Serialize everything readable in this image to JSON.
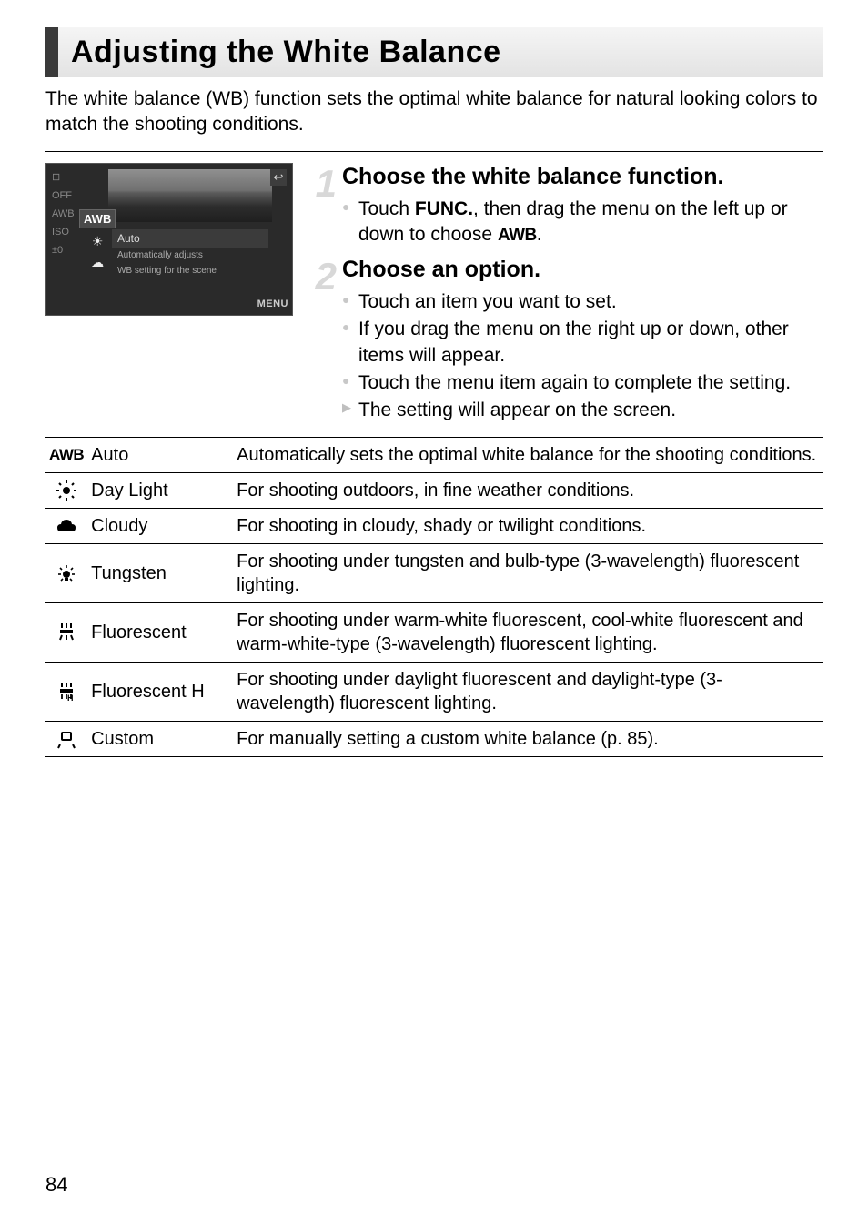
{
  "page_number": "84",
  "title": "Adjusting the White Balance",
  "intro": "The white balance (WB) function sets the optimal white balance for natural looking colors to match the shooting conditions.",
  "screenshot": {
    "selected": "AWB",
    "option_label": "Auto",
    "option_desc1": "Automatically adjusts",
    "option_desc2": "WB setting for the scene",
    "menu_label": "MENU",
    "back_glyph": "↩",
    "side_icons": [
      "☀",
      "☁"
    ],
    "left_misc": [
      "⊡",
      "OFF",
      "AWB",
      "ISO",
      "±0"
    ]
  },
  "steps": [
    {
      "num": "1",
      "title": "Choose the white balance function.",
      "bullets": [
        {
          "type": "dot",
          "pre": "Touch ",
          "bold": "FUNC.",
          "mid": ", then drag the menu on the left up or down to choose ",
          "awb": "AWB",
          "post": "."
        }
      ]
    },
    {
      "num": "2",
      "title": "Choose an option.",
      "bullets": [
        {
          "type": "dot",
          "text": "Touch an item you want to set."
        },
        {
          "type": "dot",
          "text": "If you drag the menu on the right up or down, other items will appear."
        },
        {
          "type": "dot",
          "text": "Touch the menu item again to complete the setting."
        },
        {
          "type": "arrow",
          "text": "The setting will appear on the screen."
        }
      ]
    }
  ],
  "table": [
    {
      "icon": "awb",
      "label": "Auto",
      "desc": "Automatically sets the optimal white balance for the shooting conditions."
    },
    {
      "icon": "sun",
      "label": "Day Light",
      "desc": "For shooting outdoors, in fine weather conditions."
    },
    {
      "icon": "cloud",
      "label": "Cloudy",
      "desc": "For shooting in cloudy, shady or twilight conditions."
    },
    {
      "icon": "bulb",
      "label": "Tungsten",
      "desc": "For shooting under tungsten and bulb-type (3-wavelength) fluorescent lighting."
    },
    {
      "icon": "fluo",
      "label": "Fluorescent",
      "desc": "For shooting under warm-white fluorescent, cool-white fluorescent and warm-white-type (3-wavelength) fluorescent lighting."
    },
    {
      "icon": "fluoh",
      "label": "Fluorescent H",
      "desc": "For shooting under daylight fluorescent and daylight-type (3-wavelength) fluorescent lighting."
    },
    {
      "icon": "custom",
      "label": "Custom",
      "desc": "For manually setting a custom white balance (p. 85)."
    }
  ]
}
